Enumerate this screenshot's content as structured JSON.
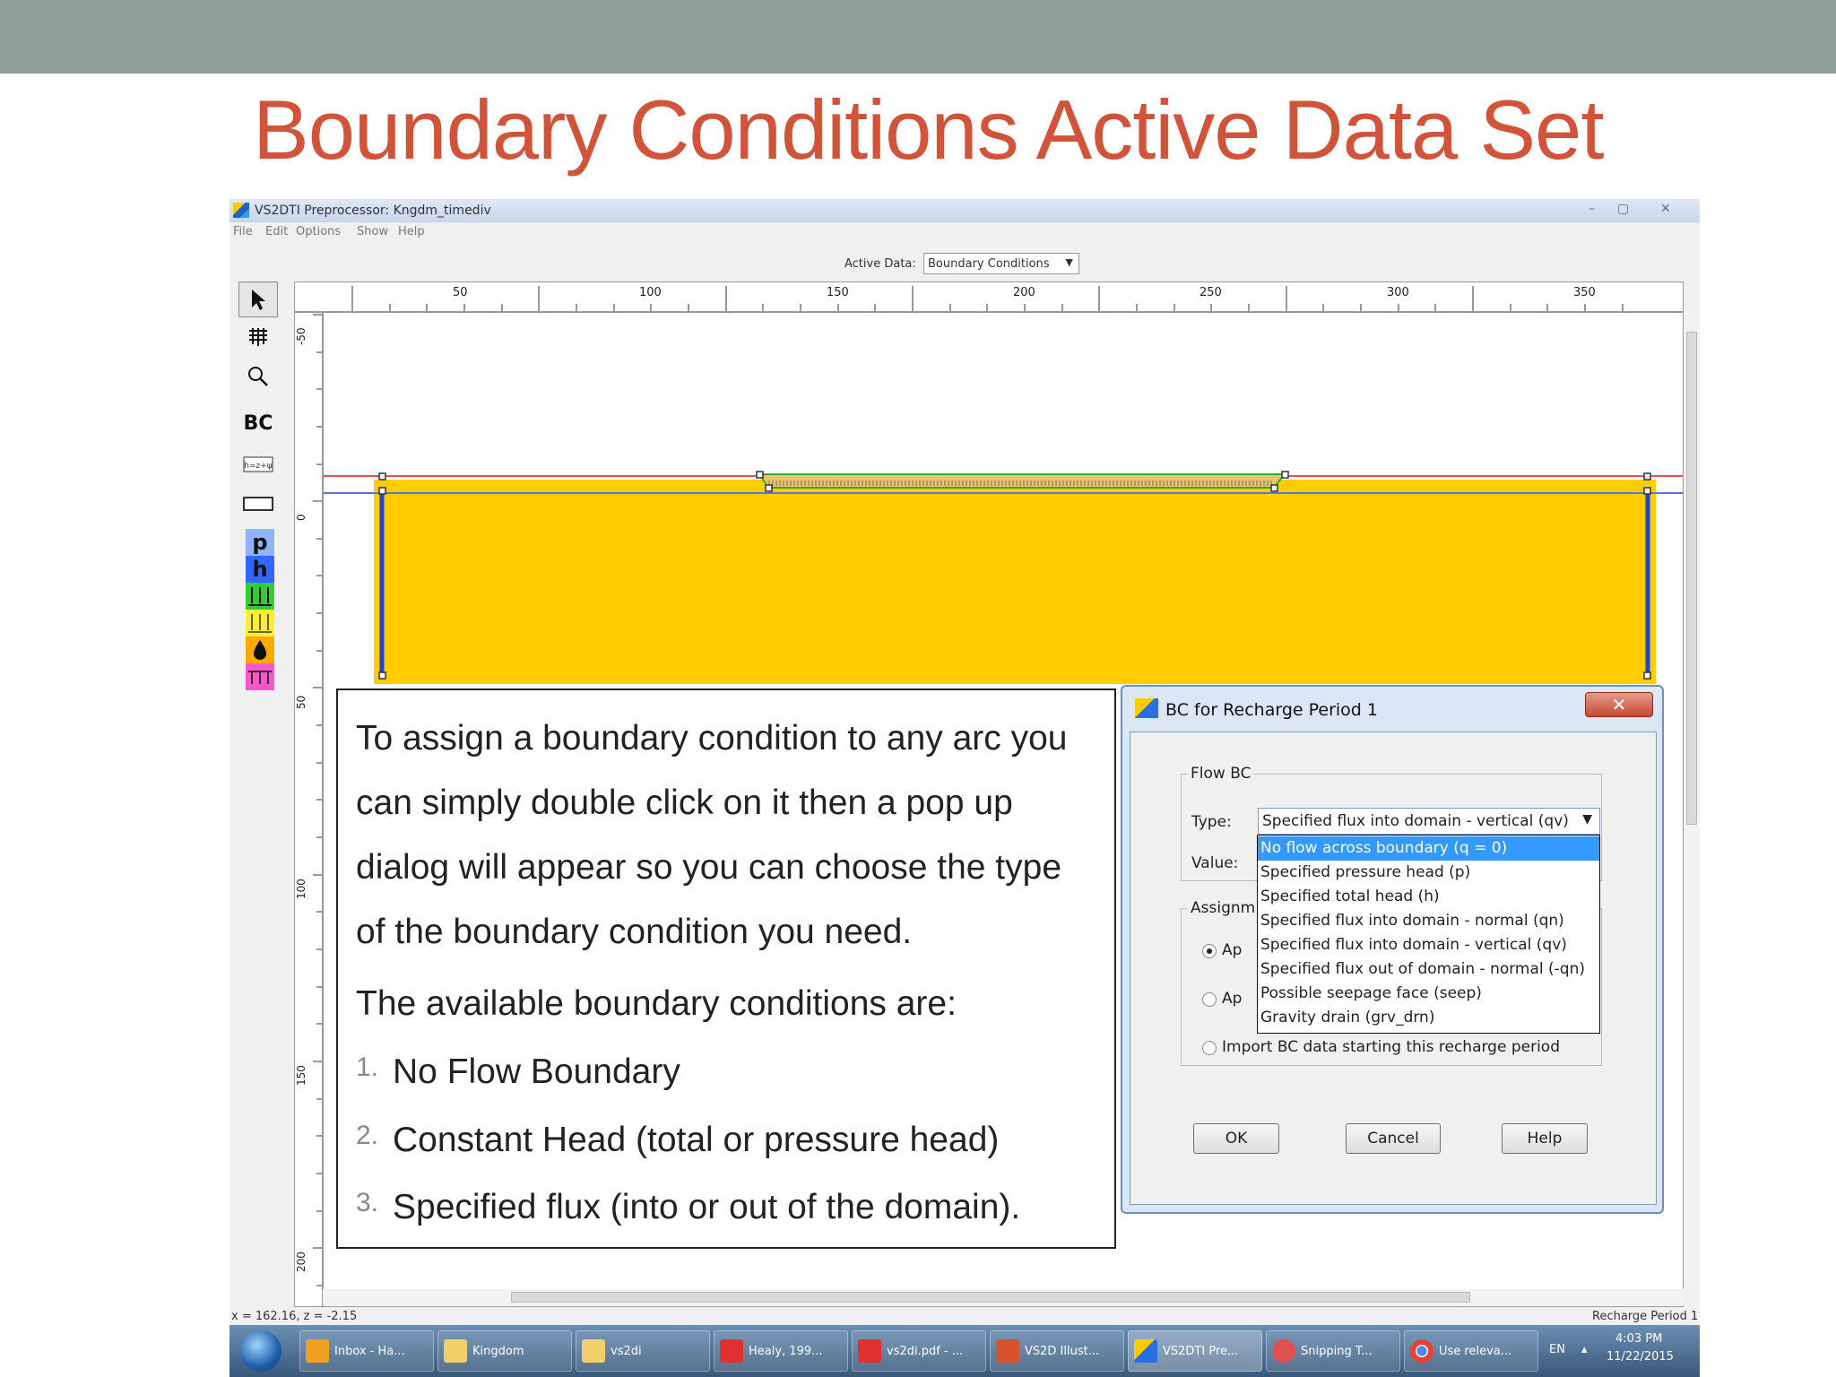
{
  "slide": {
    "title": "Boundary Conditions Active Data Set"
  },
  "window": {
    "title": "VS2DTI Preprocessor: Kngdm_timediv",
    "controls": [
      "–",
      "▢",
      "✕"
    ]
  },
  "menu": [
    "File",
    "Edit",
    "Options",
    "Show",
    "Help"
  ],
  "toolbar": {
    "active_data_label": "Active Data:",
    "active_data_value": "Boundary Conditions"
  },
  "tools": {
    "bc_label": "BC",
    "p_label": "p",
    "h_label": "h",
    "colors": {
      "p": "#8fb3ff",
      "h": "#3366ff",
      "flux_green": "#33cc33",
      "flux_yellow": "#ffee33",
      "seep": "#ffaa00",
      "drain": "#ff55cc"
    }
  },
  "rulers": {
    "top_ticks": [
      "50",
      "100",
      "150",
      "200",
      "250",
      "300",
      "350"
    ],
    "left_ticks": [
      "-50",
      "0",
      "50",
      "100",
      "150",
      "200"
    ]
  },
  "domain": {
    "fill_color": "#ffcc00",
    "boundary_color": "#2244cc",
    "water_table_color": "#e8534a"
  },
  "status": {
    "coords": "x = 162.16, z = -2.15",
    "period": "Recharge Period 1"
  },
  "taskbar": {
    "items": [
      "Inbox - Ha...",
      "Kingdom",
      "vs2di",
      "Healy, 199...",
      "vs2di.pdf - ...",
      "VS2D Illust...",
      "VS2DTI Pre...",
      "Snipping T...",
      "Use releva..."
    ],
    "lang": "EN",
    "time": "4:03 PM",
    "date": "11/22/2015"
  },
  "textbox": {
    "lines": [
      "To assign a boundary condition to any arc you",
      "can simply double click on it then a pop up",
      "dialog will appear so you can choose the type",
      "of the boundary condition you need."
    ],
    "intro": "The available boundary conditions are:",
    "items": [
      {
        "num": "1.",
        "text": "No Flow Boundary"
      },
      {
        "num": "2.",
        "text": "Constant Head (total or pressure head)"
      },
      {
        "num": "3.",
        "text": "Specified flux (into or out of the domain)."
      }
    ]
  },
  "dialog": {
    "title": "BC for Recharge Period 1",
    "close": "✕",
    "flow_bc_legend": "Flow BC",
    "type_label": "Type:",
    "type_value": "Specified flux into domain - vertical (qv)",
    "value_label": "Value:",
    "assign_legend": "Assignm",
    "radio1_label": "Ap",
    "radio2_label": "Ap",
    "radio3_label": "Import BC data starting this recharge period",
    "options": [
      "No flow across boundary (q = 0)",
      "Specified pressure head (p)",
      "Specified total head (h)",
      "Specified flux into domain - normal (qn)",
      "Specified flux into domain - vertical (qv)",
      "Specified flux out of domain - normal (-qn)",
      "Possible seepage face (seep)",
      "Gravity drain (grv_drn)"
    ],
    "selected_option_index": 0,
    "ok": "OK",
    "cancel": "Cancel",
    "help": "Help"
  }
}
